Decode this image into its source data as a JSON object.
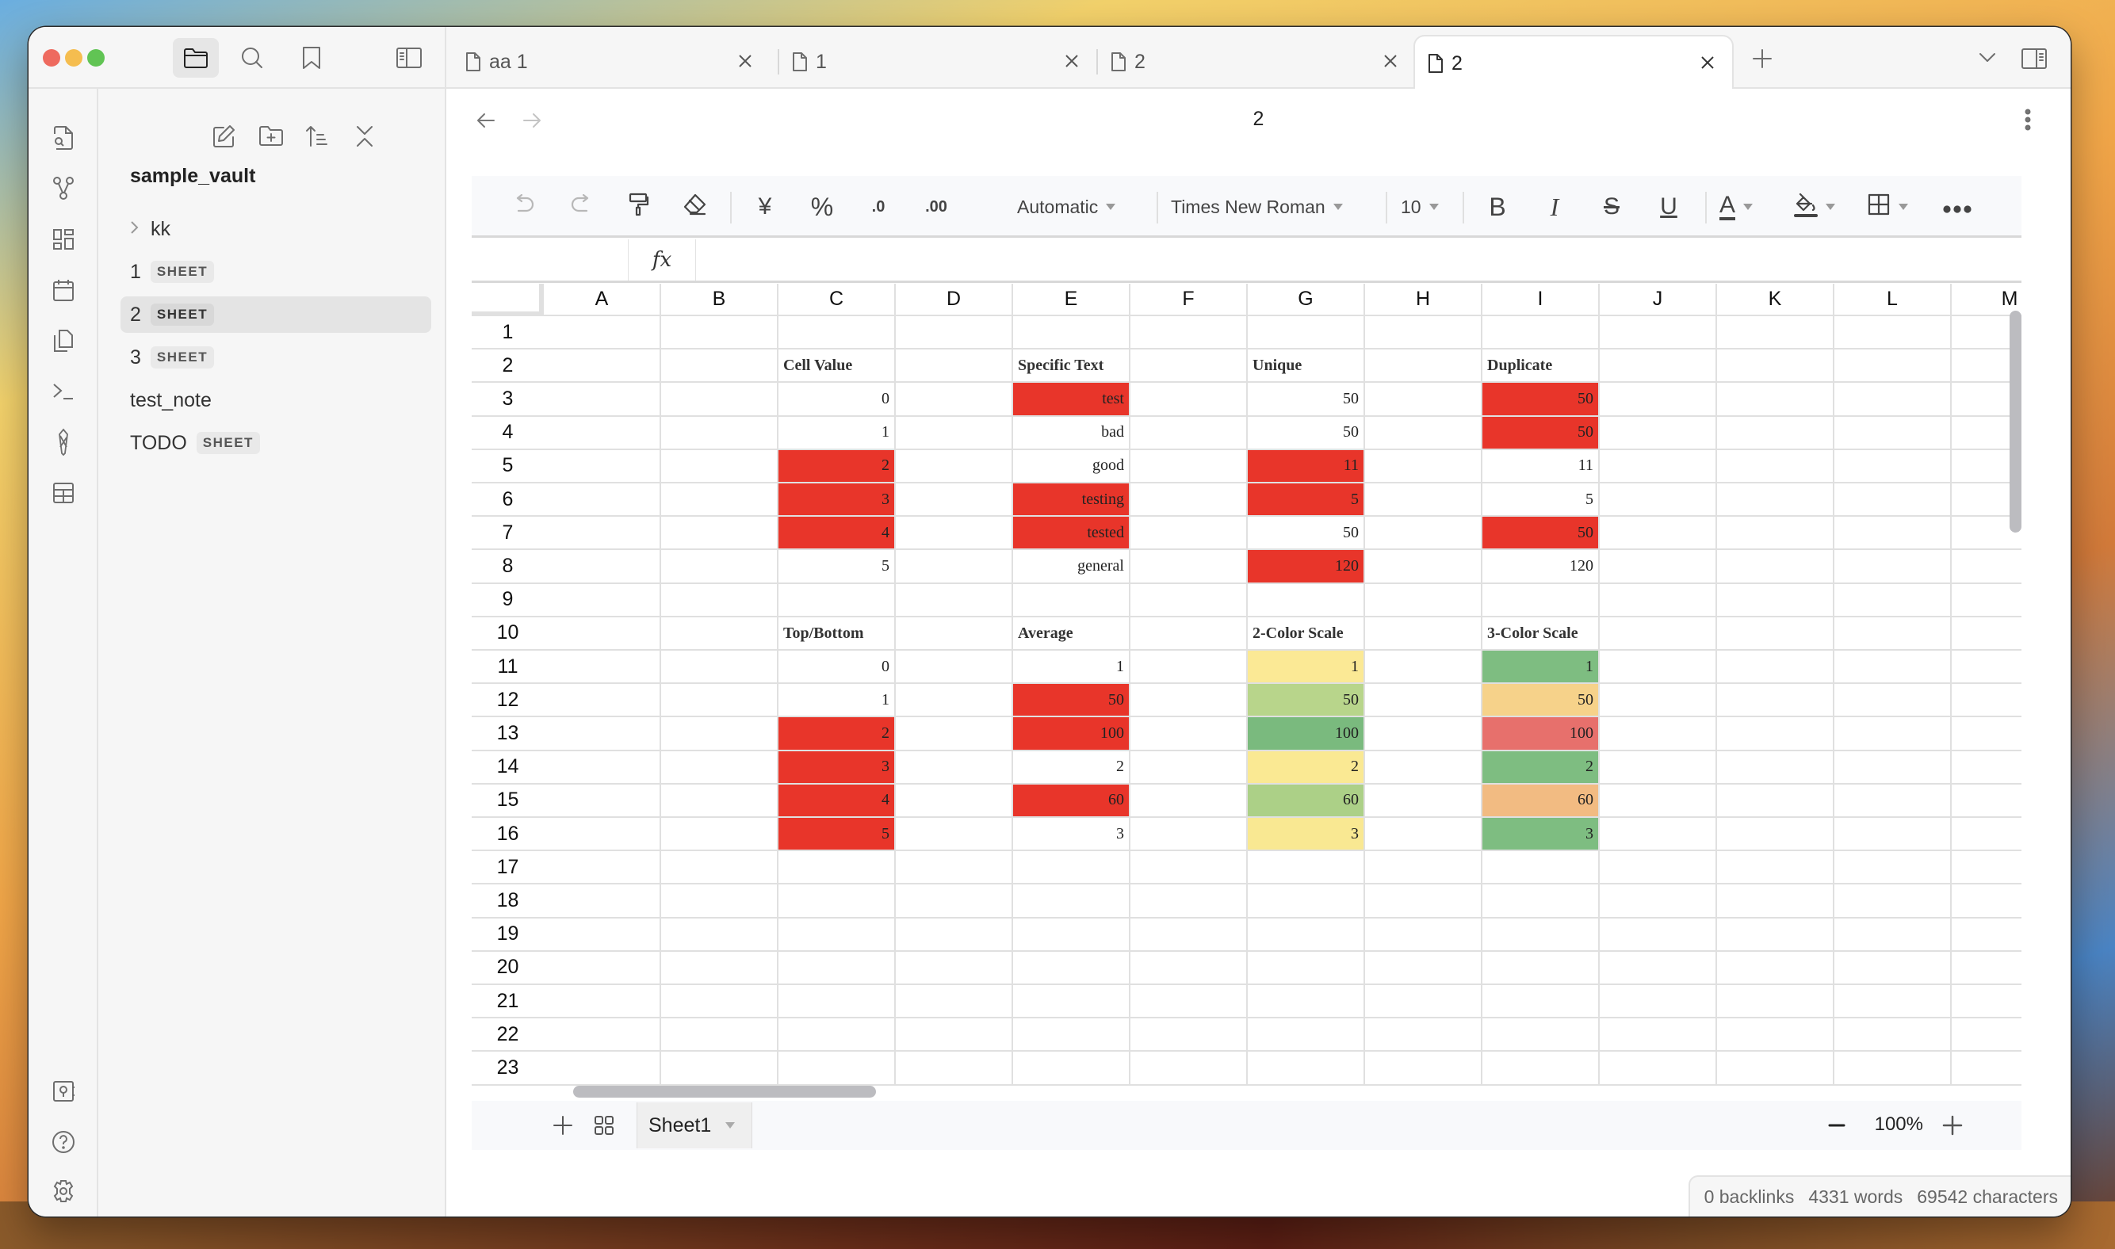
{
  "window": {
    "traffic_lights": {
      "close": "#ee6a5f",
      "minimize": "#f5bd4f",
      "zoom": "#61c454"
    }
  },
  "titlebar": {
    "buttons": [
      {
        "name": "file-explorer",
        "icon": "folder-icon",
        "active": true
      },
      {
        "name": "search",
        "icon": "search-icon",
        "active": false
      },
      {
        "name": "bookmarks",
        "icon": "bookmark-icon",
        "active": false
      }
    ],
    "sidebar_toggle_icon": "sidebar-toggle-icon"
  },
  "ribbon": {
    "top_icons": [
      "file-search-icon",
      "graph-icon",
      "dashboard-icon",
      "calendar-icon",
      "copy-icon",
      "terminal-icon",
      "excalidraw-icon",
      "table-icon"
    ],
    "bottom_icons": [
      "vault-icon",
      "help-icon",
      "settings-icon"
    ]
  },
  "sidebar": {
    "actions": [
      "new-note-icon",
      "new-folder-icon",
      "sort-icon",
      "collapse-all-icon"
    ],
    "vault_name": "sample_vault",
    "items": [
      {
        "label": "kk",
        "type": "folder",
        "badge": null,
        "selected": false
      },
      {
        "label": "1",
        "type": "file",
        "badge": "SHEET",
        "selected": false
      },
      {
        "label": "2",
        "type": "file",
        "badge": "SHEET",
        "selected": true
      },
      {
        "label": "3",
        "type": "file",
        "badge": "SHEET",
        "selected": false
      },
      {
        "label": "test_note",
        "type": "file",
        "badge": null,
        "selected": false
      },
      {
        "label": "TODO",
        "type": "file",
        "badge": "SHEET",
        "selected": false
      }
    ]
  },
  "tabs": [
    {
      "label": "aa 1",
      "active": false
    },
    {
      "label": "1",
      "active": false
    },
    {
      "label": "2",
      "active": false
    },
    {
      "label": "2",
      "active": true
    }
  ],
  "navbar": {
    "title": "2"
  },
  "toolbar": {
    "number_format": "Automatic",
    "font_family": "Times New Roman",
    "font_size": "10",
    "currency_symbol": "¥",
    "percent_symbol": "%",
    "decrease_decimal": ".0",
    "increase_decimal": ".00",
    "bold": "B",
    "italic": "I",
    "strike": "S",
    "underline": "U",
    "font_color": "A"
  },
  "formula_bar": {
    "cell_ref": "",
    "fx_label": "fx",
    "value": ""
  },
  "grid": {
    "columns": [
      "A",
      "B",
      "C",
      "D",
      "E",
      "F",
      "G",
      "H",
      "I",
      "J",
      "K",
      "L",
      "M"
    ],
    "rows": [
      "1",
      "2",
      "3",
      "4",
      "5",
      "6",
      "7",
      "8",
      "9",
      "10",
      "11",
      "12",
      "13",
      "14",
      "15",
      "16",
      "17",
      "18",
      "19",
      "20",
      "21",
      "22",
      "23"
    ],
    "highlight_red": "#e8352a",
    "cells": [
      {
        "ref": "C2",
        "value": "Cell Value",
        "title": true
      },
      {
        "ref": "C3",
        "value": "0"
      },
      {
        "ref": "C4",
        "value": "1"
      },
      {
        "ref": "C5",
        "value": "2",
        "bg": "#e8352a"
      },
      {
        "ref": "C6",
        "value": "3",
        "bg": "#e8352a"
      },
      {
        "ref": "C7",
        "value": "4",
        "bg": "#e8352a"
      },
      {
        "ref": "C8",
        "value": "5"
      },
      {
        "ref": "E2",
        "value": "Specific Text",
        "title": true
      },
      {
        "ref": "E3",
        "value": "test",
        "bg": "#e8352a"
      },
      {
        "ref": "E4",
        "value": "bad"
      },
      {
        "ref": "E5",
        "value": "good"
      },
      {
        "ref": "E6",
        "value": "testing",
        "bg": "#e8352a"
      },
      {
        "ref": "E7",
        "value": "tested",
        "bg": "#e8352a"
      },
      {
        "ref": "E8",
        "value": "general"
      },
      {
        "ref": "G2",
        "value": "Unique",
        "title": true
      },
      {
        "ref": "G3",
        "value": "50"
      },
      {
        "ref": "G4",
        "value": "50"
      },
      {
        "ref": "G5",
        "value": "11",
        "bg": "#e8352a"
      },
      {
        "ref": "G6",
        "value": "5",
        "bg": "#e8352a"
      },
      {
        "ref": "G7",
        "value": "50"
      },
      {
        "ref": "G8",
        "value": "120",
        "bg": "#e8352a"
      },
      {
        "ref": "I2",
        "value": "Duplicate",
        "title": true
      },
      {
        "ref": "I3",
        "value": "50",
        "bg": "#e8352a"
      },
      {
        "ref": "I4",
        "value": "50",
        "bg": "#e8352a"
      },
      {
        "ref": "I5",
        "value": "11"
      },
      {
        "ref": "I6",
        "value": "5"
      },
      {
        "ref": "I7",
        "value": "50",
        "bg": "#e8352a"
      },
      {
        "ref": "I8",
        "value": "120"
      },
      {
        "ref": "C10",
        "value": "Top/Bottom",
        "title": true
      },
      {
        "ref": "C11",
        "value": "0"
      },
      {
        "ref": "C12",
        "value": "1"
      },
      {
        "ref": "C13",
        "value": "2",
        "bg": "#e8352a"
      },
      {
        "ref": "C14",
        "value": "3",
        "bg": "#e8352a"
      },
      {
        "ref": "C15",
        "value": "4",
        "bg": "#e8352a"
      },
      {
        "ref": "C16",
        "value": "5",
        "bg": "#e8352a"
      },
      {
        "ref": "E10",
        "value": "Average",
        "title": true
      },
      {
        "ref": "E11",
        "value": "1"
      },
      {
        "ref": "E12",
        "value": "50",
        "bg": "#e8352a"
      },
      {
        "ref": "E13",
        "value": "100",
        "bg": "#e8352a"
      },
      {
        "ref": "E14",
        "value": "2"
      },
      {
        "ref": "E15",
        "value": "60",
        "bg": "#e8352a"
      },
      {
        "ref": "E16",
        "value": "3"
      },
      {
        "ref": "G10",
        "value": "2-Color Scale",
        "title": true
      },
      {
        "ref": "G11",
        "value": "1",
        "bg": "#fbe995"
      },
      {
        "ref": "G12",
        "value": "50",
        "bg": "#b8d58b"
      },
      {
        "ref": "G13",
        "value": "100",
        "bg": "#7aba7e"
      },
      {
        "ref": "G14",
        "value": "2",
        "bg": "#fae993"
      },
      {
        "ref": "G15",
        "value": "60",
        "bg": "#acd087"
      },
      {
        "ref": "G16",
        "value": "3",
        "bg": "#f9e892"
      },
      {
        "ref": "I10",
        "value": "3-Color Scale",
        "title": true
      },
      {
        "ref": "I11",
        "value": "1",
        "bg": "#7ebd81"
      },
      {
        "ref": "I12",
        "value": "50",
        "bg": "#f6d28a"
      },
      {
        "ref": "I13",
        "value": "100",
        "bg": "#e7706c"
      },
      {
        "ref": "I14",
        "value": "2",
        "bg": "#7ebd81"
      },
      {
        "ref": "I15",
        "value": "60",
        "bg": "#f2bb82"
      },
      {
        "ref": "I16",
        "value": "3",
        "bg": "#7ebd81"
      }
    ]
  },
  "sheetbar": {
    "active_sheet": "Sheet1",
    "zoom": "100%"
  },
  "statusbar": {
    "backlinks": "0 backlinks",
    "words": "4331 words",
    "characters": "69542 characters"
  }
}
